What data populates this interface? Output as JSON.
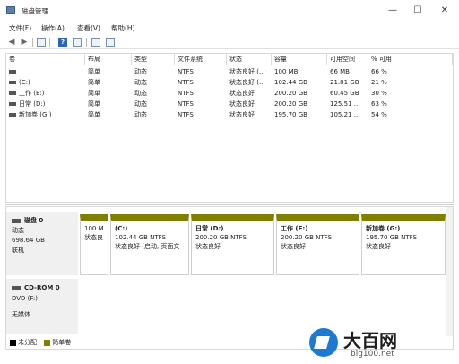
{
  "window": {
    "title": "磁盘管理",
    "minimize": "—",
    "maximize": "☐",
    "close": "✕"
  },
  "menu": [
    "文件(F)",
    "操作(A)",
    "查看(V)",
    "帮助(H)"
  ],
  "toolbar": {
    "back": "◀",
    "forward": "▶",
    "help": "?"
  },
  "columns": [
    "卷",
    "布局",
    "类型",
    "文件系统",
    "状态",
    "容量",
    "可用空间",
    "% 可用"
  ],
  "volumes": [
    [
      "",
      "简单",
      "动态",
      "NTFS",
      "状态良好 (...",
      "100 MB",
      "66 MB",
      "66 %"
    ],
    [
      "(C:)",
      "简单",
      "动态",
      "NTFS",
      "状态良好 (...",
      "102.44 GB",
      "21.81 GB",
      "21 %"
    ],
    [
      "工作 (E:)",
      "简单",
      "动态",
      "NTFS",
      "状态良好",
      "200.20 GB",
      "60.45 GB",
      "30 %"
    ],
    [
      "日常 (D:)",
      "简单",
      "动态",
      "NTFS",
      "状态良好",
      "200.20 GB",
      "125.51 ...",
      "63 %"
    ],
    [
      "新加卷 (G:)",
      "简单",
      "动态",
      "NTFS",
      "状态良好",
      "195.70 GB",
      "105.21 ...",
      "54 %"
    ]
  ],
  "disk0": {
    "name": "磁盘 0",
    "type": "动态",
    "size": "698.64 GB",
    "status": "联机",
    "partitions": [
      {
        "label": "",
        "line1": "100 M",
        "line2": "状态良"
      },
      {
        "label": "(C:)",
        "line1": "102.44 GB NTFS",
        "line2": "状态良好 (启动, 页面文"
      },
      {
        "label": "日常  (D:)",
        "line1": "200.20 GB NTFS",
        "line2": "状态良好"
      },
      {
        "label": "工作  (E:)",
        "line1": "200.20 GB NTFS",
        "line2": "状态良好"
      },
      {
        "label": "新加卷  (G:)",
        "line1": "195.70 GB NTFS",
        "line2": "状态良好"
      }
    ]
  },
  "cdrom": {
    "name": "CD-ROM 0",
    "drive": "DVD (F:)",
    "media": "无媒体"
  },
  "legend": {
    "unallocated": "未分配",
    "simple": "简单卷",
    "unallocated_color": "#000000",
    "simple_color": "#808000"
  },
  "watermark": {
    "title": "大百网",
    "url": "big100.net"
  }
}
